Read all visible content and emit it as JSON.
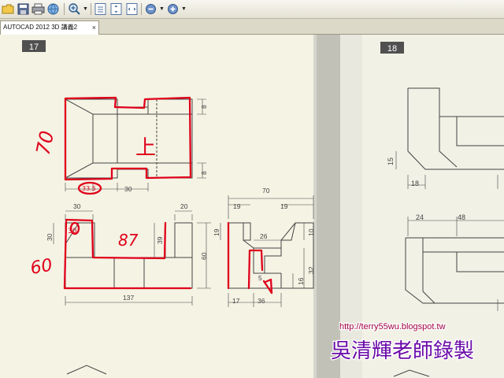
{
  "toolbar": {
    "buttons": [
      {
        "name": "open-button",
        "icon": "folder-icon"
      },
      {
        "name": "save-button",
        "icon": "floppy-disk-icon"
      },
      {
        "name": "print-button",
        "icon": "printer-icon"
      },
      {
        "name": "share-button",
        "icon": "globe-icon"
      },
      {
        "name": "zoom-in-tool-button",
        "icon": "magnifier-plus-icon"
      },
      {
        "name": "actual-size-button",
        "icon": "actual-size-icon"
      },
      {
        "name": "fit-page-button",
        "icon": "fit-page-icon"
      },
      {
        "name": "fit-width-button",
        "icon": "fit-width-icon"
      },
      {
        "name": "zoom-out-button",
        "icon": "zoom-out-icon"
      },
      {
        "name": "zoom-in-button",
        "icon": "zoom-in-icon"
      }
    ]
  },
  "tab": {
    "title": "AUTOCAD 2012 3D 講義2",
    "close_glyph": "×"
  },
  "drawing": {
    "exercise_left": "17",
    "exercise_right": "18",
    "dimensions_left": {
      "top_8": "8",
      "bottom_8": "8",
      "d_30_below": "30",
      "d_30_top": "30",
      "d_20": "20",
      "d_30_side": "30",
      "d_39": "39",
      "d_60": "60",
      "d_137": "137"
    },
    "dimensions_middle": {
      "d_70": "70",
      "d_19_left": "19",
      "d_19_right": "19",
      "d_19_vert": "19",
      "d_26": "26",
      "d_10": "10",
      "d_5": "5",
      "d_16": "16",
      "d_32": "32",
      "d_17": "17",
      "d_36": "36"
    },
    "dimensions_right": {
      "d_15": "15",
      "d_18": "18",
      "d_24": "24",
      "d_48": "48"
    },
    "annotations": {
      "hand_70": "70",
      "hand_up": "上",
      "hand_circled": "33.5",
      "hand_30": "30",
      "hand_87": "87",
      "hand_60": "60"
    },
    "watermark_url": "http://terry55wu.blogspot.tw",
    "watermark_credit": "吳清輝老師錄製"
  },
  "colors": {
    "ink": "#444444",
    "marker": "#e0001a",
    "paper": "#f4f3e4",
    "watermark_url": "#a00040",
    "watermark_credit": "#6a0aa8"
  }
}
